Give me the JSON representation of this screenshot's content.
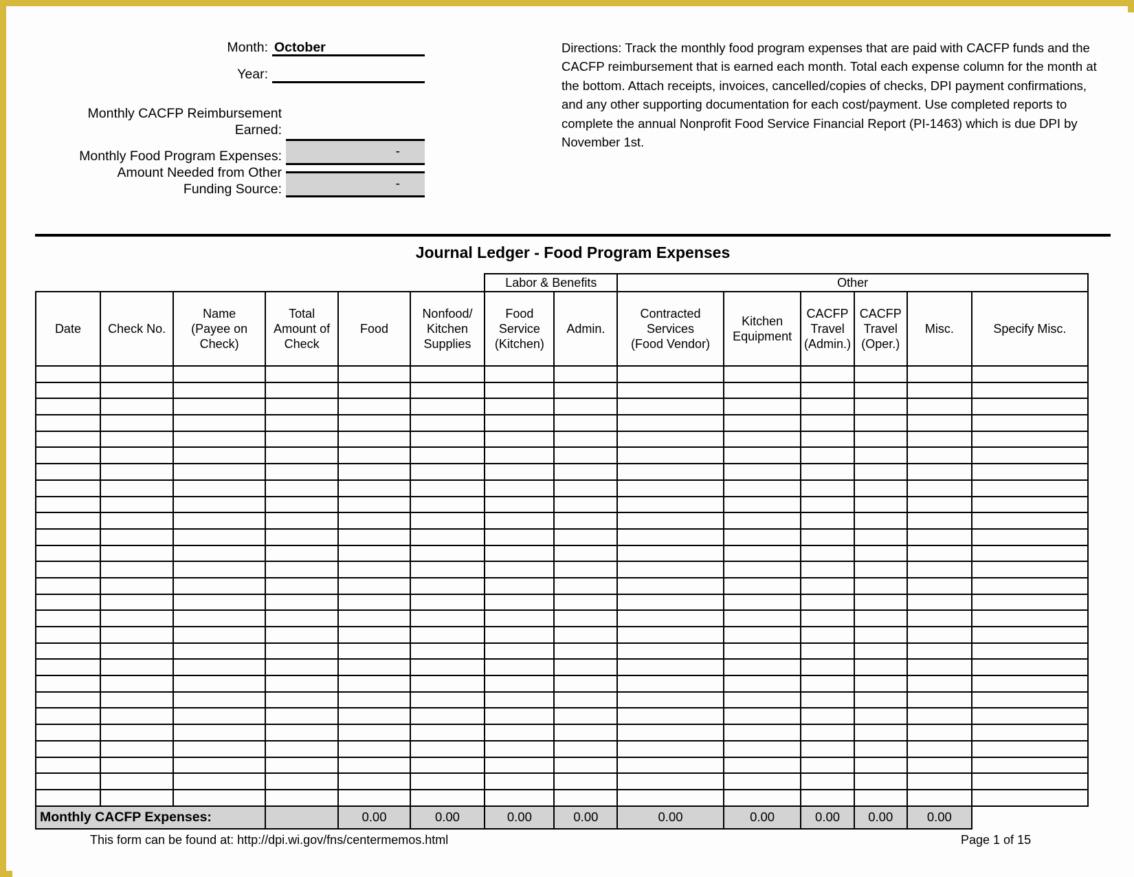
{
  "form": {
    "month_label": "Month:",
    "month_value": "October",
    "year_label": "Year:",
    "year_value": "",
    "reimbursement_label": "Monthly CACFP Reimbursement\nEarned:",
    "reimbursement_value": "",
    "expenses_label": "Monthly Food Program Expenses:",
    "expenses_value": "-",
    "other_funding_label": "Amount Needed from Other\nFunding Source:",
    "other_funding_value": "-"
  },
  "directions": {
    "text": "Directions: Track the monthly food program expenses that are paid with CACFP funds and the CACFP reimbursement that is earned each month. Total each expense column for the month at the bottom. Attach receipts, invoices, cancelled/copies of checks, DPI payment confirmations, and any other supporting documentation for each cost/payment. Use completed reports to complete  the annual Nonprofit Food Service Financial Report (PI-1463) which is due DPI by November 1st."
  },
  "ledger": {
    "title": "Journal Ledger - Food Program Expenses",
    "group_headers": [
      {
        "label": "",
        "span": 6,
        "bordered": false
      },
      {
        "label": "Labor & Benefits",
        "span": 2,
        "bordered": true
      },
      {
        "label": "Other",
        "span": 6,
        "bordered": true
      }
    ],
    "columns": [
      "Date",
      "Check No.",
      "Name\n(Payee on\nCheck)",
      "Total\nAmount of\nCheck",
      "Food",
      "Nonfood/\nKitchen\nSupplies",
      "Food\nService\n(Kitchen)",
      "Admin.",
      "Contracted\nServices\n(Food Vendor)",
      "Kitchen\nEquipment",
      "CACFP\nTravel\n(Admin.)",
      "CACFP\nTravel\n(Oper.)",
      "Misc.",
      "Specify Misc."
    ],
    "blank_row_count": 27,
    "totals_label": "Monthly CACFP Expenses:",
    "totals": [
      "",
      "0.00",
      "0.00",
      "0.00",
      "0.00",
      "0.00",
      "0.00",
      "0.00",
      "0.00",
      "0.00",
      ""
    ]
  },
  "footer": {
    "note": "This form can be found at: http://dpi.wi.gov/fns/centermemos.html",
    "page": "Page 1 of 15"
  },
  "colors": {
    "frame": "#d6b93c",
    "shaded_cell": "#d3d3d3",
    "rule": "#000000"
  }
}
